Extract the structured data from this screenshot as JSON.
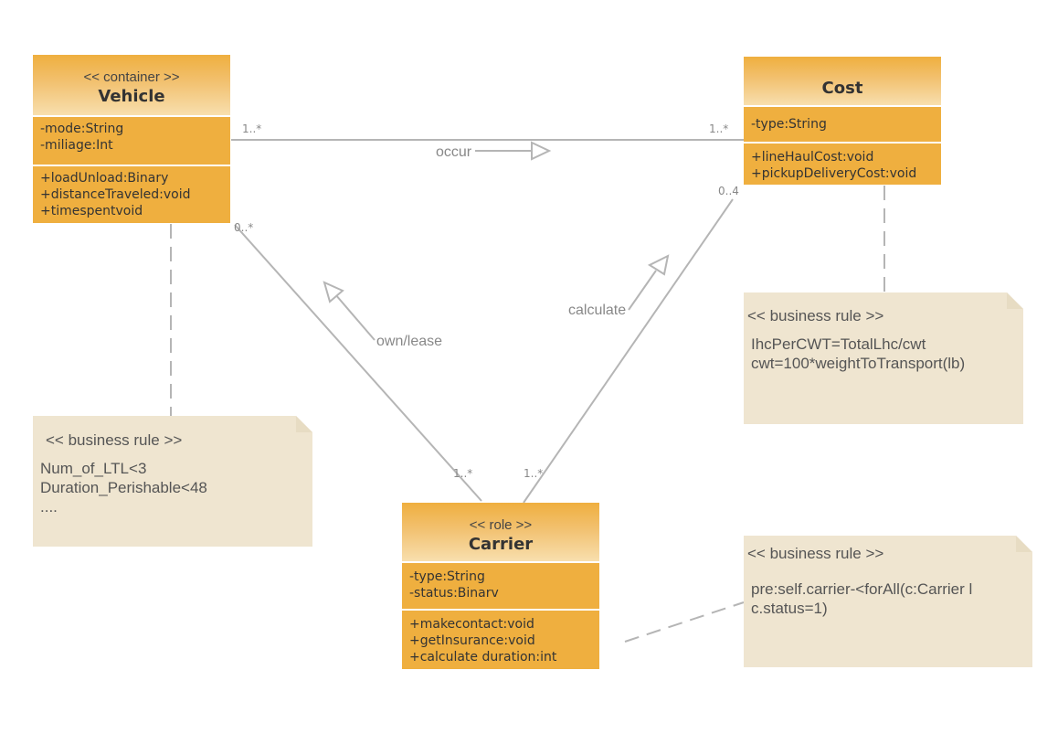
{
  "classes": {
    "vehicle": {
      "stereotype": "<< container >>",
      "name": "Vehicle",
      "attributes": [
        "-mode:String",
        "-miliage:Int"
      ],
      "operations": [
        "+loadUnload:Binary",
        "+distanceTraveled:void",
        "+timespentvoid"
      ]
    },
    "cost": {
      "stereotype": "",
      "name": "Cost",
      "attributes": [
        "-type:String"
      ],
      "operations": [
        "+lineHaulCost:void",
        "+pickupDeliveryCost:void"
      ]
    },
    "carrier": {
      "stereotype": "<< role >>",
      "name": "Carrier",
      "attributes": [
        "-type:String",
        "-status:Binarv"
      ],
      "operations": [
        "+makecontact:void",
        "+getInsurance:void",
        "+calculate duration:int"
      ]
    }
  },
  "notes": {
    "vehicle_rule": {
      "stereotype": "<< business rule >>",
      "lines": [
        "Num_of_LTL<3",
        "Duration_Perishable<48",
        "...."
      ]
    },
    "cost_rule": {
      "stereotype": "<< business rule >>",
      "lines": [
        "IhcPerCWT=TotalLhc/cwt",
        "cwt=100*weightToTransport(lb)"
      ]
    },
    "carrier_rule": {
      "stereotype": "<< business rule >>",
      "lines": [
        "pre:self.carrier-<forAll(c:Carrier l",
        "c.status=1)"
      ]
    }
  },
  "associations": {
    "occur": {
      "label": "occur",
      "source_mult": "1..*",
      "target_mult": "1..*"
    },
    "own_lease": {
      "label": "own/lease",
      "source_mult": "1..*",
      "target_mult": "0..*"
    },
    "calculate": {
      "label": "calculate",
      "source_mult": "1..*",
      "target_mult": "0..4"
    }
  },
  "colors": {
    "class_fill": "#efaf3f",
    "note_fill": "#efe5d0",
    "line": "#b5b5b5"
  }
}
